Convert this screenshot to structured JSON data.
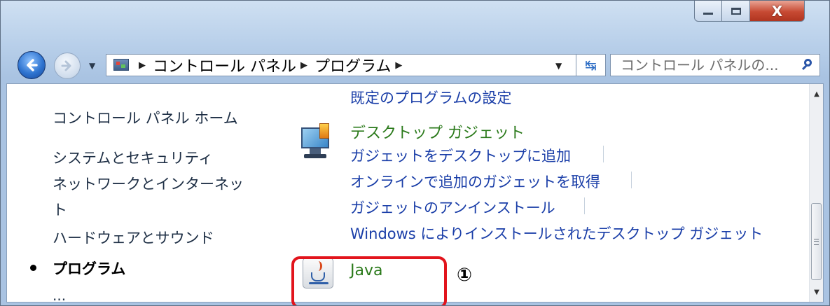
{
  "window": {
    "minimize": "minimize",
    "maximize": "maximize",
    "close": "X"
  },
  "nav": {
    "address": [
      "コントロール パネル",
      "プログラム"
    ],
    "search_placeholder": "コントロール パネルの..."
  },
  "sidebar": {
    "items": [
      {
        "label": "コントロール パネル ホーム"
      },
      {
        "label": "システムとセキュリティ"
      },
      {
        "label": "ネットワークとインターネッ"
      },
      {
        "label": "ト"
      },
      {
        "label": "ハードウェアとサウンド"
      },
      {
        "label": "プログラム"
      }
    ],
    "cut_label": "..."
  },
  "main": {
    "default_programs_link": "既定のプログラムの設定",
    "gadgets": {
      "heading": "デスクトップ ガジェット",
      "links": [
        "ガジェットをデスクトップに追加",
        "オンラインで追加のガジェットを取得",
        "ガジェットのアンインストール",
        "Windows によりインストールされたデスクトップ ガジェット"
      ]
    },
    "java": {
      "heading": "Java",
      "callout": "①"
    }
  },
  "icons": {
    "back": "back-arrow-icon",
    "forward": "forward-arrow-icon",
    "refresh": "refresh-icon",
    "search": "search-icon",
    "control_panel": "control-panel-icon",
    "gadget": "desktop-gadget-icon",
    "java": "java-cup-icon"
  },
  "colors": {
    "link": "#1a3ea8",
    "heading": "#2b7a1b",
    "highlight": "#e2141c",
    "close_button": "#c74a33"
  }
}
